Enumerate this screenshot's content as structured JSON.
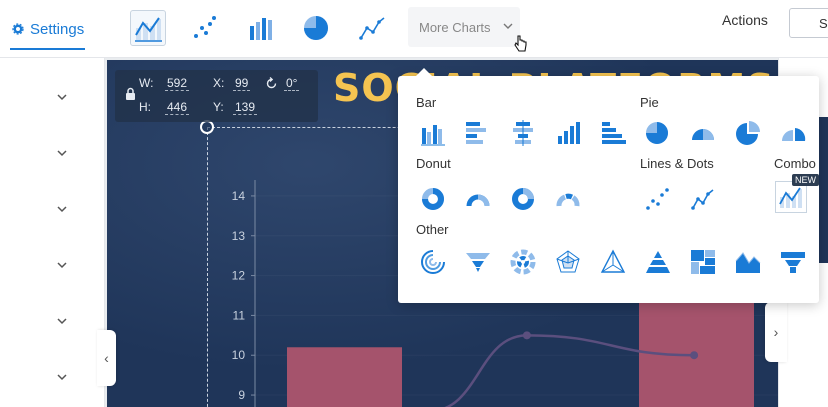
{
  "toolbar": {
    "settings_label": "Settings",
    "more_charts_label": "More Charts",
    "actions_label": "Actions",
    "sh_label": "Sh",
    "chart_buttons": [
      "combo-chart-icon",
      "scatter-chart-icon",
      "bar-chart-icon",
      "pie-chart-icon",
      "line-chart-icon"
    ]
  },
  "canvas": {
    "banner_title": "SOCIAL PLATFORMS",
    "dims": {
      "w_label": "W:",
      "w": "592",
      "h_label": "H:",
      "h": "446",
      "x_label": "X:",
      "x": "99",
      "y_label": "Y:",
      "y": "139",
      "rotation": "0°"
    }
  },
  "chart_data": {
    "type": "bar",
    "title": "",
    "xlabel": "",
    "ylabel": "",
    "yticks": [
      "14",
      "13",
      "12",
      "11",
      "10",
      "9"
    ],
    "ylim": [
      8.7,
      14.4
    ],
    "bars": [
      {
        "x": 0,
        "value": 10.2
      },
      {
        "x": 2,
        "value": 12.6
      }
    ],
    "line": {
      "points": [
        {
          "x": 0.6,
          "value": 8.6
        },
        {
          "x": 1.15,
          "value": 10.5
        },
        {
          "x": 2.1,
          "value": 10.0
        }
      ],
      "marked": [
        1,
        2
      ]
    },
    "colors": {
      "bar": "#a5536c",
      "line": "#5b4f7e",
      "axis": "#7a8aa3",
      "label": "#c9d2df"
    }
  },
  "dropdown": {
    "sections": {
      "bar": "Bar",
      "pie": "Pie",
      "donut": "Donut",
      "lines_dots": "Lines & Dots",
      "combo": "Combo",
      "other": "Other"
    },
    "new_badge": "NEW",
    "bar_icons": [
      "bar-vertical-icon",
      "bar-horizontal-icon",
      "bar-centered-icon",
      "bar-ascending-icon",
      "bar-horizontal-stacked-icon"
    ],
    "pie_icons": [
      "pie-icon",
      "half-pie-icon",
      "pie-exploded-icon",
      "pie-split-icon"
    ],
    "donut_icons": [
      "donut-icon",
      "half-donut-icon",
      "donut-thick-icon",
      "half-donut-segmented-icon"
    ],
    "lines_icons": [
      "scatter-icon",
      "line-dots-icon"
    ],
    "combo_icons": [
      "combo-icon"
    ],
    "other_icons": [
      "radial-icon",
      "funnel-icon",
      "sunburst-icon",
      "radar-icon",
      "triangle-network-icon",
      "pyramid-icon",
      "treemap-icon",
      "area-icon",
      "funnel-stacked-icon"
    ],
    "accent": "#1a7bd6"
  }
}
